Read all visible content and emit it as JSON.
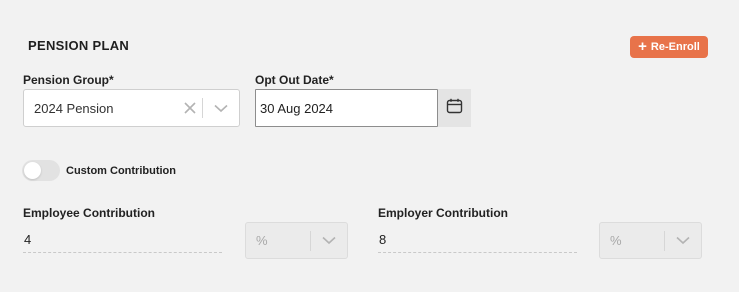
{
  "section": {
    "title": "PENSION PLAN",
    "reenroll_label": "Re-Enroll",
    "reenroll_icon": "plus-icon",
    "accent_color": "#e8734a"
  },
  "pension_group": {
    "label": "Pension Group*",
    "value": "2024 Pension"
  },
  "opt_out_date": {
    "label": "Opt Out Date*",
    "value": "30 Aug 2024",
    "icon": "calendar-icon"
  },
  "custom_contribution": {
    "label": "Custom Contribution",
    "enabled": false
  },
  "employee_contribution": {
    "label": "Employee Contribution",
    "value": "4",
    "unit": "%"
  },
  "employer_contribution": {
    "label": "Employer Contribution",
    "value": "8",
    "unit": "%"
  }
}
